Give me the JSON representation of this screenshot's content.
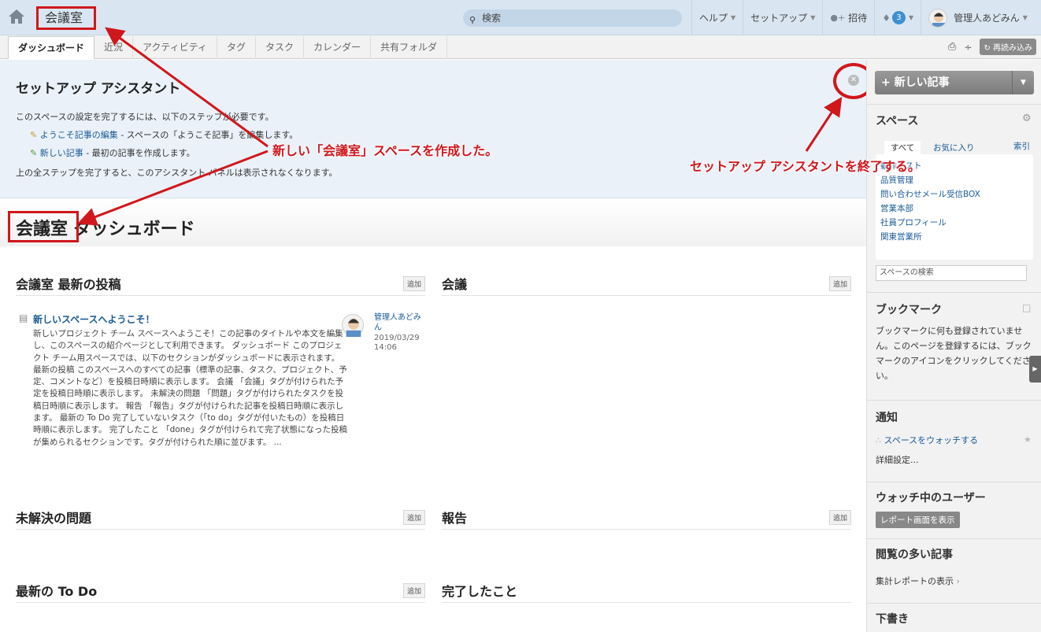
{
  "header": {
    "space_name": "会議室",
    "search_placeholder": "検索",
    "help": "ヘルプ",
    "setup": "セットアップ",
    "invite": "招待",
    "notif_count": "3",
    "user": "管理人あどみん"
  },
  "tabs": [
    "ダッシュボード",
    "近況",
    "アクティビティ",
    "タグ",
    "タスク",
    "カレンダー",
    "共有フォルダ"
  ],
  "toolbar": {
    "reload": "再読み込み"
  },
  "setup": {
    "title": "セットアップ アシスタント",
    "intro": "このスペースの設定を完了するには、以下のステップが必要です。",
    "step1_link": "ようこそ記事の編集",
    "step1_text": " - スペースの「ようこそ記事」を編集します。",
    "step2_link": "新しい記事",
    "step2_text": " - 最初の記事を作成します。",
    "footer": "上の全ステップを完了すると、このアシスタント パネルは表示されなくなります。"
  },
  "dashboard": {
    "space": "会議室",
    "title": " ダッシュボード"
  },
  "sections": {
    "recent": "会議室 最新の投稿",
    "meetings": "会議",
    "issues": "未解決の問題",
    "reports": "報告",
    "todo": "最新の To Do",
    "done": "完了したこと",
    "add": "追加"
  },
  "post": {
    "title": "新しいスペースへようこそ！",
    "body": "新しいプロジェクト チーム スペースへようこそ！この記事のタイトルや本文を編集し、このスペースの紹介ページとして利用できます。 ダッシュボード このプロジェクト チーム用スペースでは、以下のセクションがダッシュボードに表示されます。 最新の投稿 このスペースへのすべての記事（標準の記事、タスク、プロジェクト、予定、コメントなど）を投稿日時順に表示します。 会議 「会議」タグが付けられた予定を投稿日時順に表示します。 未解決の問題 「問題」タグが付けられたタスクを投稿日時順に表示します。 報告 「報告」タグが付けられた記事を投稿日時順に表示します。 最新の To Do 完了していないタスク（「to do」タグが付いたもの）を投稿日時順に表示します。 完了したこと 「done」タグが付けられて完了状態になった投稿が集められるセクションです。タグが付けられた順に並びます。 ...",
    "author": "管理人あどみん",
    "date": "2019/03/29 14:06"
  },
  "sidebar": {
    "new_post": "新しい記事",
    "spaces_title": "スペース",
    "filter_all": "すべて",
    "filter_fav": "お気に入り",
    "index": "索引",
    "spaces": [
      "動作テスト",
      "品質管理",
      "問い合わせメール受信BOX",
      "営業本部",
      "社員プロフィール",
      "関東営業所"
    ],
    "space_search": "スペースの検索",
    "bookmarks_title": "ブックマーク",
    "bookmarks_text": "ブックマークに何も登録されていません。このページを登録するには、ブックマークのアイコンをクリックしてください。",
    "notify_title": "通知",
    "watch_space": "スペースをウォッチする",
    "detail_settings": "詳細設定...",
    "watchers_title": "ウォッチ中のユーザー",
    "report_btn": "レポート画面を表示",
    "popular_title": "閲覧の多い記事",
    "stats_report": "集計レポートの表示",
    "drafts_title": "下書き"
  },
  "annotations": {
    "created": "新しい「会議室」スペースを作成した。",
    "close": "セットアップ アシスタントを終了する。"
  },
  "colors": {
    "annotation": "#d0171c",
    "topbar": "#d9e6f1",
    "link": "#1a5a96"
  }
}
